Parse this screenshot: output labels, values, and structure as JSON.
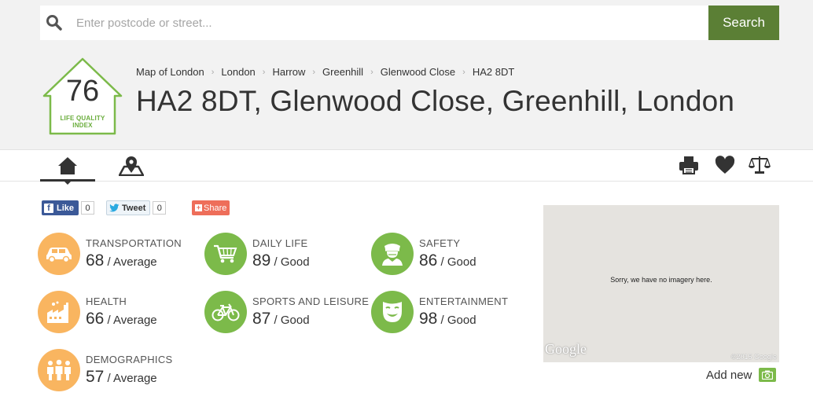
{
  "search": {
    "placeholder": "Enter postcode or street...",
    "button_label": "Search"
  },
  "lqi": {
    "score": "76",
    "label_line1": "LIFE QUALITY",
    "label_line2": "INDEX"
  },
  "breadcrumb": [
    "Map of London",
    "London",
    "Harrow",
    "Greenhill",
    "Glenwood Close",
    "HA2 8DT"
  ],
  "page_title": "HA2 8DT, Glenwood Close, Greenhill, London",
  "tabs": [
    {
      "icon": "home-icon",
      "active": true
    },
    {
      "icon": "map-pin-icon",
      "active": false
    }
  ],
  "tools": [
    "print-icon",
    "heart-icon",
    "scales-icon"
  ],
  "social": {
    "like_label": "Like",
    "like_count": "0",
    "tweet_label": "Tweet",
    "tweet_count": "0",
    "share_label": "Share"
  },
  "categories": [
    {
      "name": "TRANSPORTATION",
      "score": "68",
      "rating": " / Average",
      "color": "#f9b560",
      "icon": "car-icon"
    },
    {
      "name": "DAILY LIFE",
      "score": "89",
      "rating": " / Good",
      "color": "#7cba4a",
      "icon": "shopping-cart-icon"
    },
    {
      "name": "SAFETY",
      "score": "86",
      "rating": " / Good",
      "color": "#7cba4a",
      "icon": "police-officer-icon"
    },
    {
      "name": "HEALTH",
      "score": "66",
      "rating": " / Average",
      "color": "#f9b560",
      "icon": "factory-icon"
    },
    {
      "name": "SPORTS AND LEISURE",
      "score": "87",
      "rating": " / Good",
      "color": "#7cba4a",
      "icon": "bicycle-icon"
    },
    {
      "name": "ENTERTAINMENT",
      "score": "98",
      "rating": " / Good",
      "color": "#7cba4a",
      "icon": "theater-mask-icon"
    },
    {
      "name": "DEMOGRAPHICS",
      "score": "57",
      "rating": " / Average",
      "color": "#f9b560",
      "icon": "people-icon"
    }
  ],
  "map": {
    "message": "Sorry, we have no imagery here.",
    "logo": "Google",
    "copyright": "©2015 Google"
  },
  "add_new_label": "Add new",
  "colors": {
    "accent": "#5b7f35",
    "good": "#7cba4a",
    "average": "#f9b560",
    "share": "#ee6e5a",
    "facebook": "#3b5998"
  }
}
